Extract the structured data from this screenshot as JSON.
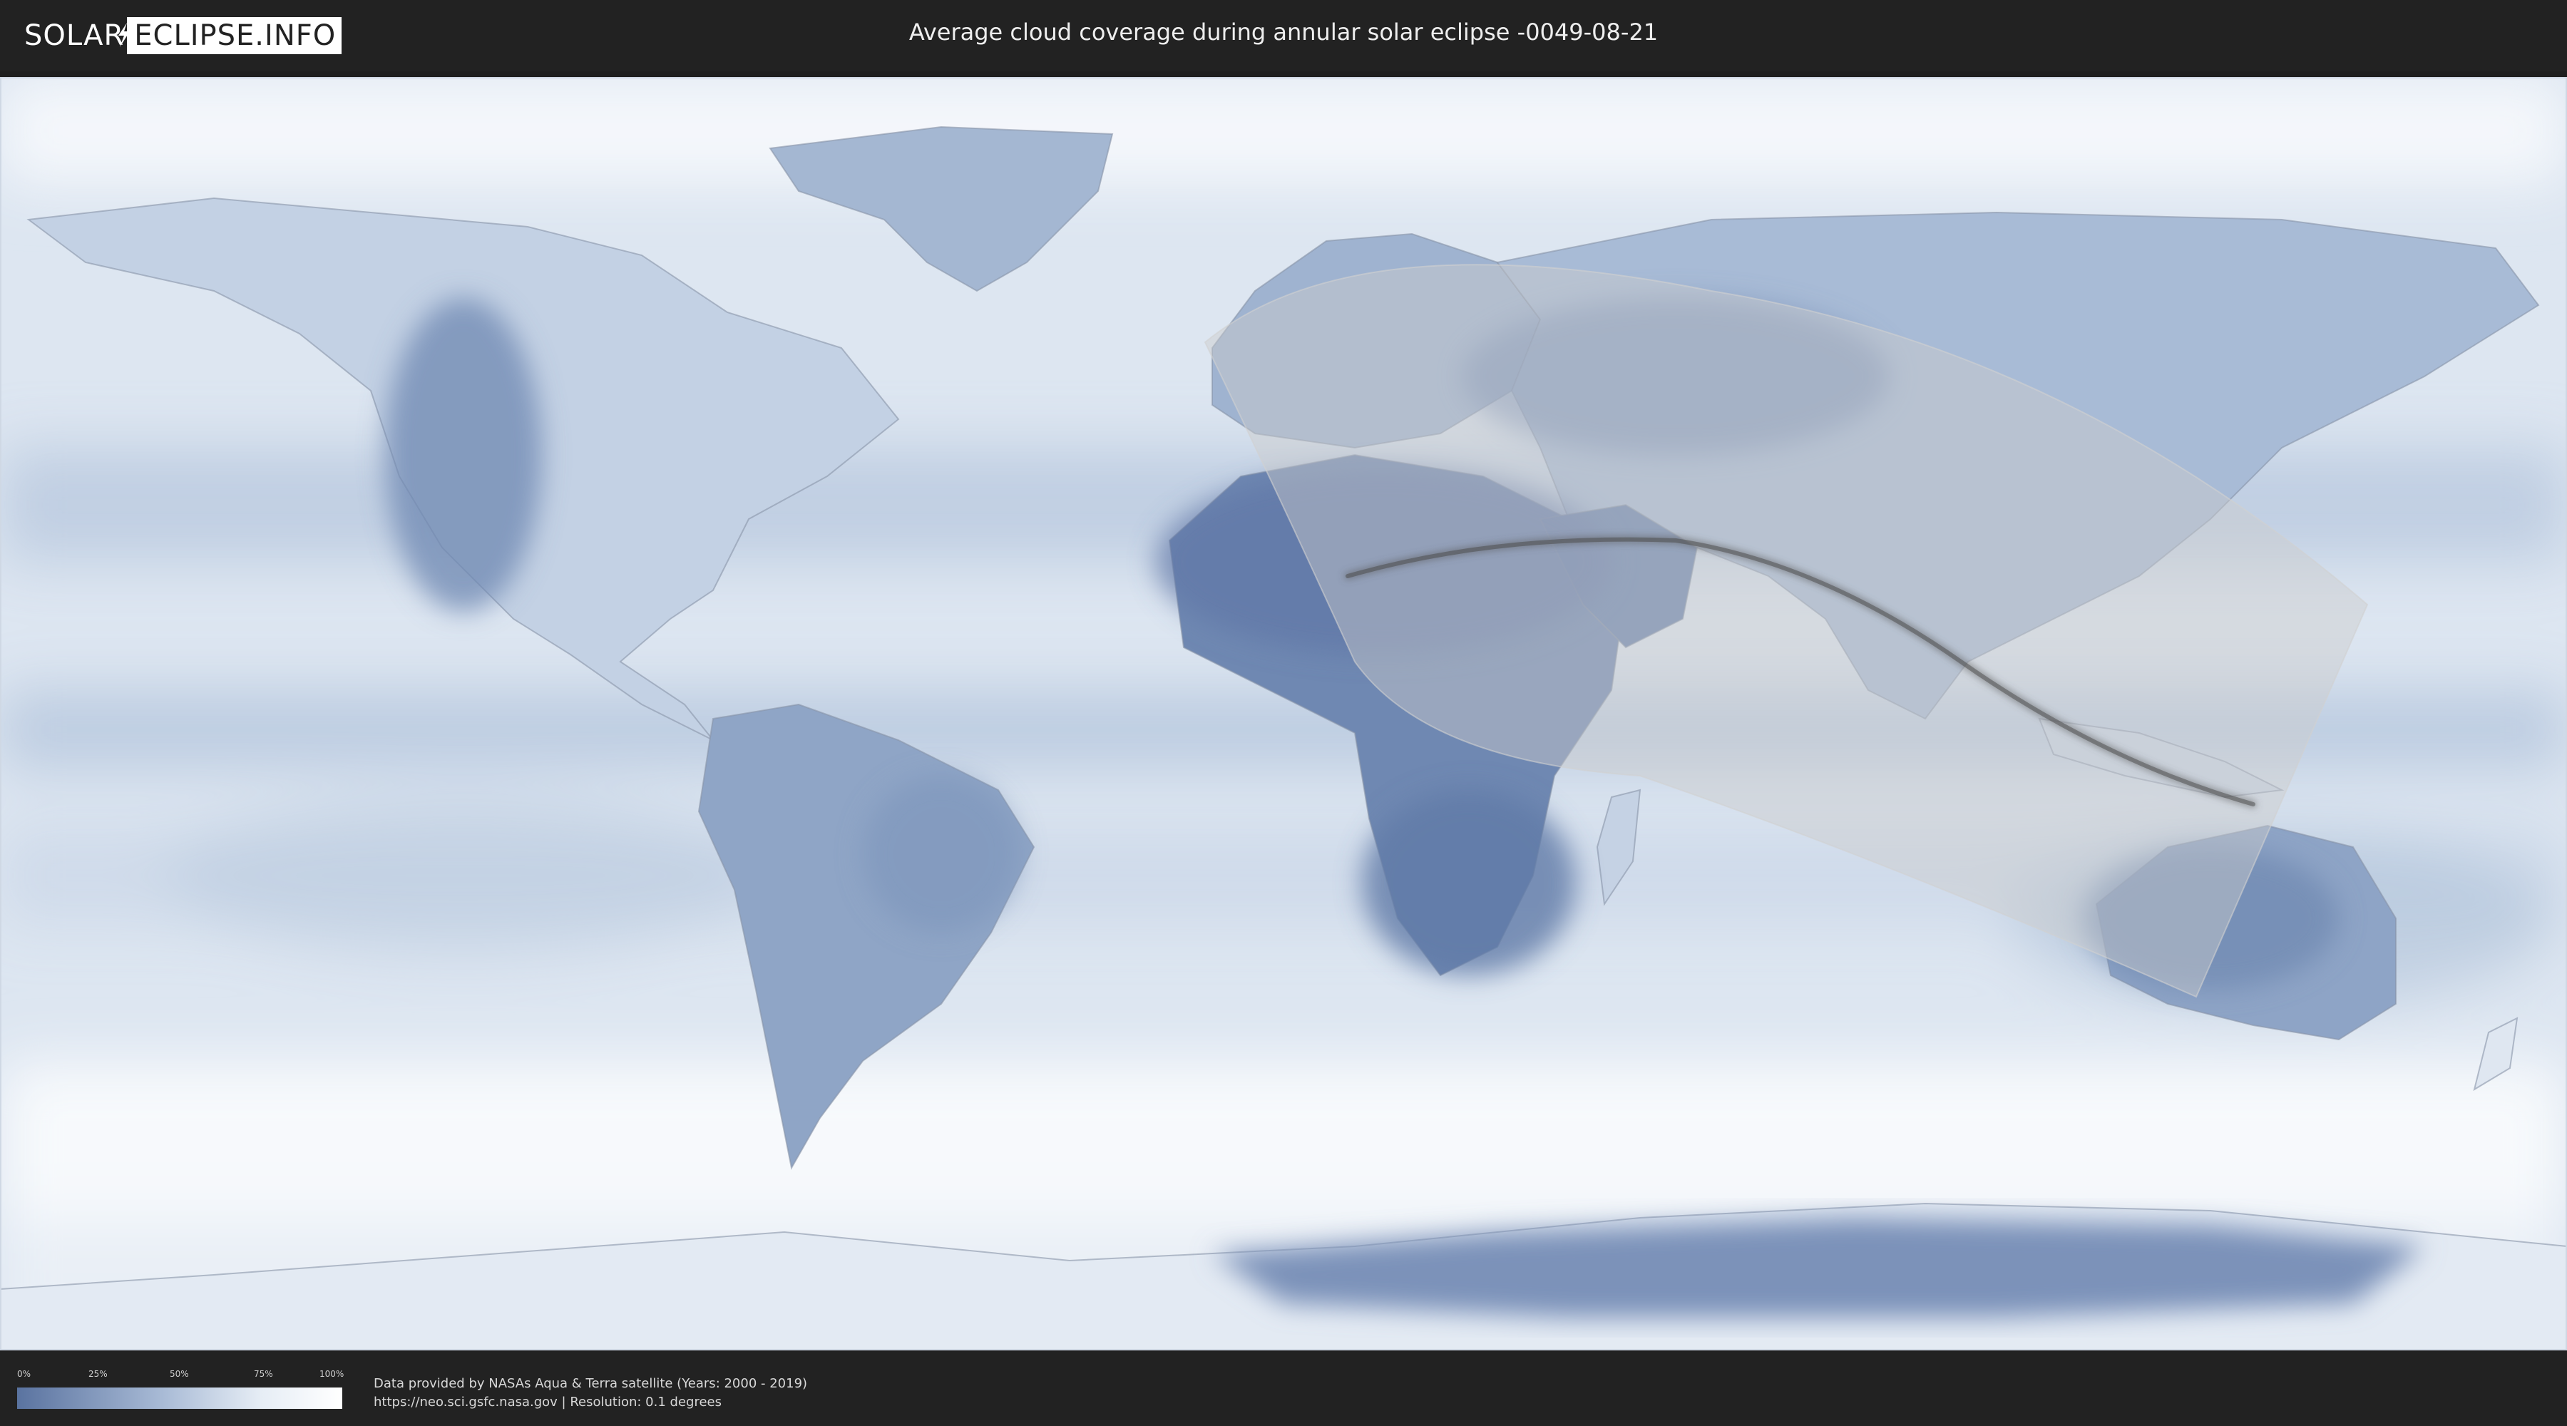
{
  "header": {
    "logo_left": "SOLAR",
    "logo_right": "ECLIPSE.INFO",
    "title": "Average cloud coverage during annular solar eclipse -0049-08-21"
  },
  "legend": {
    "labels": [
      "0%",
      "25%",
      "50%",
      "75%",
      "100%"
    ],
    "colors": {
      "clear": "#5a73a0",
      "full": "#ffffff"
    }
  },
  "credits": {
    "line1": "Data provided by NASAs Aqua & Terra satellite (Years: 2000 - 2019)",
    "line2": "https://neo.sci.gsfc.nasa.gov | Resolution: 0.1 degrees"
  },
  "map": {
    "projection": "equirectangular",
    "ocean_color": "#dfe8f2",
    "clear_land_color": "#5f78a6",
    "eclipse_overlay_color": "#c8c8c8",
    "central_line_color": "#555555"
  }
}
